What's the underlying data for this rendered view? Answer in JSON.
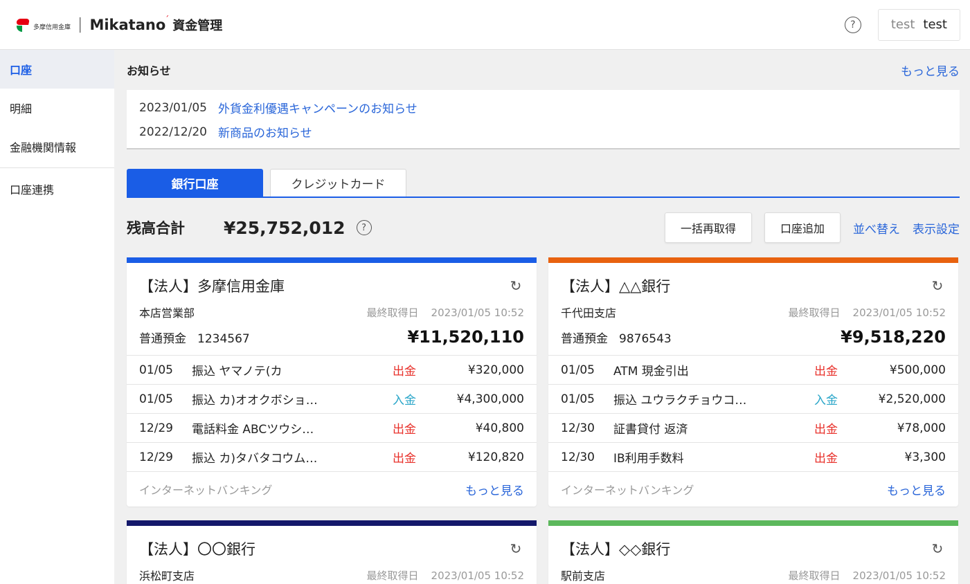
{
  "header": {
    "bank_name": "多摩信用金庫",
    "separator": "|",
    "brand": "Mikatano",
    "brand_accent": "ˊ",
    "app_name": "資金管理",
    "help_glyph": "?",
    "user_first": "test",
    "user_last": "test"
  },
  "sidebar": {
    "items": [
      {
        "label": "口座"
      },
      {
        "label": "明細"
      },
      {
        "label": "金融機関情報"
      },
      {
        "label": "口座連携"
      }
    ]
  },
  "notices": {
    "title": "お知らせ",
    "more": "もっと見る",
    "items": [
      {
        "date": "2023/01/05",
        "text": "外貨金利優遇キャンペーンのお知らせ"
      },
      {
        "date": "2022/12/20",
        "text": "新商品のお知らせ"
      }
    ]
  },
  "tabs": [
    {
      "label": "銀行口座"
    },
    {
      "label": "クレジットカード"
    }
  ],
  "balance": {
    "label": "残高合計",
    "value": "¥25,752,012",
    "help_glyph": "?",
    "refetch_all": "一括再取得",
    "add_account": "口座追加",
    "sort": "並べ替え",
    "display_settings": "表示設定"
  },
  "colors": {
    "accent": "#1a5de6",
    "out": "#e8302a",
    "in": "#2aa6c9",
    "card1": "#1a5de6",
    "card2": "#e8620f",
    "card3": "#14186b",
    "card4": "#5cb85c"
  },
  "cards": [
    {
      "title": "【法人】多摩信用金庫",
      "branch": "本店営業部",
      "updated_label": "最終取得日",
      "updated": "2023/01/05 10:52",
      "acct_type": "普通預金",
      "acct_no": "1234567",
      "balance": "¥11,520,110",
      "tx": [
        {
          "date": "01/05",
          "desc": "振込 ヤマノテ(カ",
          "type": "出金",
          "amount": "¥320,000"
        },
        {
          "date": "01/05",
          "desc": "振込 カ)オオクボショ…",
          "type": "入金",
          "amount": "¥4,300,000"
        },
        {
          "date": "12/29",
          "desc": "電話料金 ABCツウシ…",
          "type": "出金",
          "amount": "¥40,800"
        },
        {
          "date": "12/29",
          "desc": "振込 カ)タバタコウム…",
          "type": "出金",
          "amount": "¥120,820"
        }
      ],
      "source": "インターネットバンキング",
      "more": "もっと見る"
    },
    {
      "title": "【法人】△△銀行",
      "branch": "千代田支店",
      "updated_label": "最終取得日",
      "updated": "2023/01/05 10:52",
      "acct_type": "普通預金",
      "acct_no": "9876543",
      "balance": "¥9,518,220",
      "tx": [
        {
          "date": "01/05",
          "desc": "ATM 現金引出",
          "type": "出金",
          "amount": "¥500,000"
        },
        {
          "date": "01/05",
          "desc": "振込 ユウラクチョウコ…",
          "type": "入金",
          "amount": "¥2,520,000"
        },
        {
          "date": "12/30",
          "desc": "証書貸付 返済",
          "type": "出金",
          "amount": "¥78,000"
        },
        {
          "date": "12/30",
          "desc": "IB利用手数料",
          "type": "出金",
          "amount": "¥3,300"
        }
      ],
      "source": "インターネットバンキング",
      "more": "もっと見る"
    },
    {
      "title": "【法人】〇〇銀行",
      "branch": "浜松町支店",
      "updated_label": "最終取得日",
      "updated": "2023/01/05 10:52"
    },
    {
      "title": "【法人】◇◇銀行",
      "branch": "駅前支店",
      "updated_label": "最終取得日",
      "updated": "2023/01/05 10:52"
    }
  ]
}
